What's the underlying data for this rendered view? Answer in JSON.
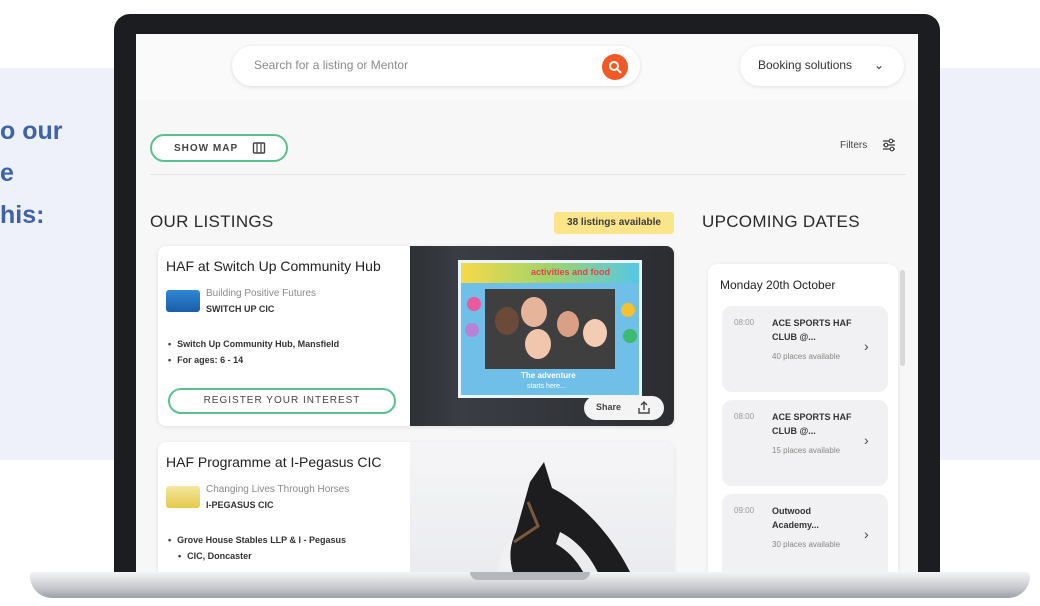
{
  "side_text": [
    "o our",
    "e",
    "his:"
  ],
  "search": {
    "placeholder": "Search for a listing or Mentor",
    "icon": "search-icon"
  },
  "booking": {
    "label": "Booking solutions",
    "icon": "chevron-down-icon"
  },
  "toolbar": {
    "show_map_label": "SHOW MAP",
    "filters_label": "Filters"
  },
  "listings": {
    "title": "OUR LISTINGS",
    "count_badge": "38 listings available",
    "cards": [
      {
        "title": "HAF at Switch Up Community Hub",
        "org_tagline": "Building Positive Futures",
        "org_name": "SWITCH UP CIC",
        "bullets": [
          "Switch Up Community Hub, Mansfield",
          "For ages: 6 - 14"
        ],
        "cta": "REGISTER YOUR INTEREST",
        "photo_banner": "activities and food",
        "photo_caption": "The adventure",
        "photo_caption2": "starts here...",
        "share_label": "Share"
      },
      {
        "title": "HAF Programme at I-Pegasus CIC",
        "org_tagline": "Changing Lives Through Horses",
        "org_name": "I-PEGASUS CIC",
        "bullets": [
          "Grove House Stables LLP & I - Pegasus",
          "CIC, Doncaster"
        ]
      }
    ]
  },
  "upcoming": {
    "title": "UPCOMING DATES",
    "day": "Monday 20th October",
    "slots": [
      {
        "time": "08:00",
        "name": "ACE SPORTS HAF CLUB @...",
        "places": "40 places available"
      },
      {
        "time": "08:00",
        "name": "ACE SPORTS HAF CLUB @...",
        "places": "15 places available"
      },
      {
        "time": "09:00",
        "name": "Outwood Academy...",
        "places": "30 places available"
      }
    ]
  },
  "colors": {
    "accent": "#f15a24",
    "outline": "#5ac18e",
    "badge": "#fbe58a",
    "side_text": "#3f63a8"
  }
}
